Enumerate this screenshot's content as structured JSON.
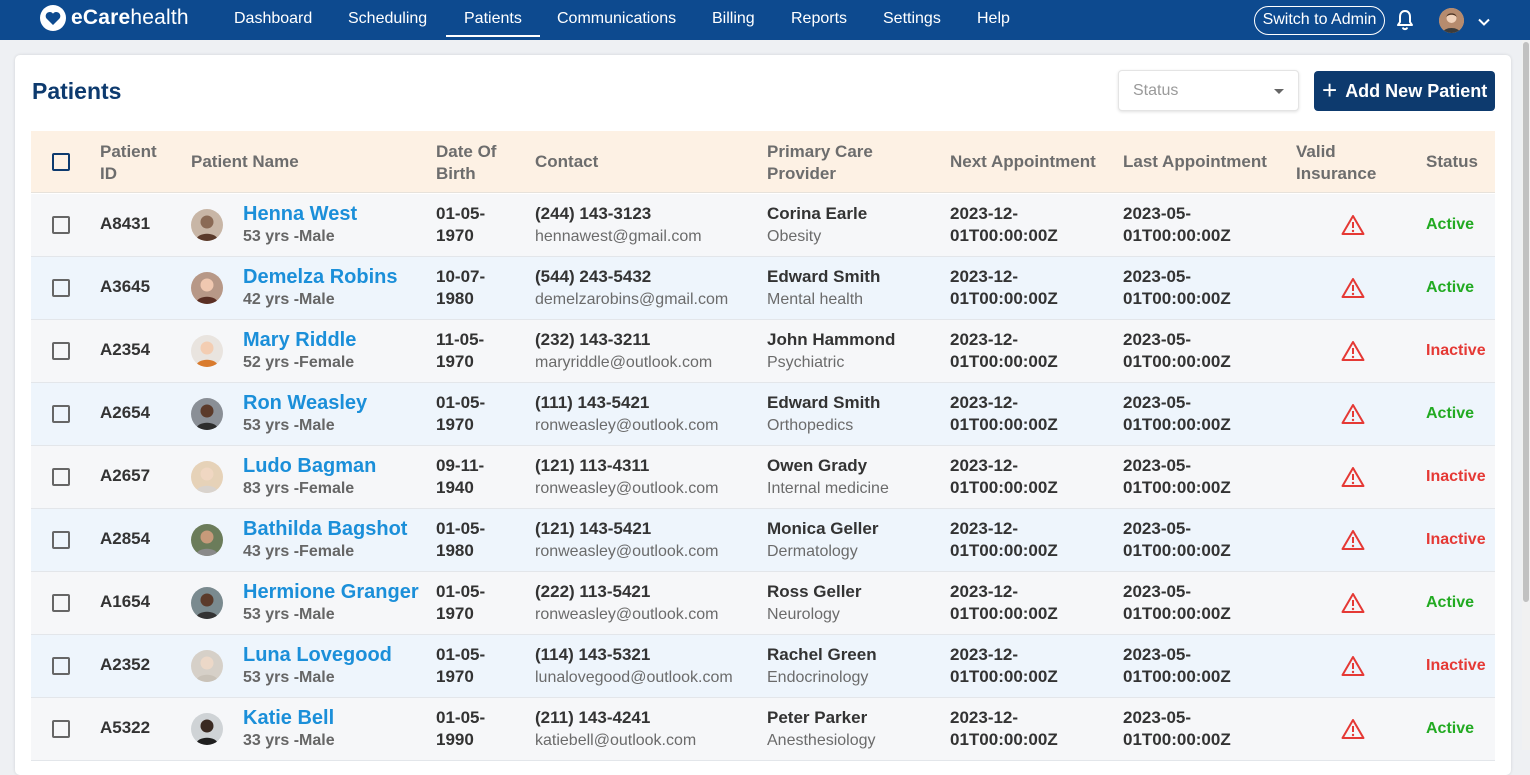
{
  "brand": {
    "name_bold": "eCare",
    "name_light": "health"
  },
  "nav": {
    "items": [
      {
        "label": "Dashboard",
        "active": false
      },
      {
        "label": "Scheduling",
        "active": false
      },
      {
        "label": "Patients",
        "active": true
      },
      {
        "label": "Communications",
        "active": false
      },
      {
        "label": "Billing",
        "active": false
      },
      {
        "label": "Reports",
        "active": false
      },
      {
        "label": "Settings",
        "active": false
      },
      {
        "label": "Help",
        "active": false
      }
    ],
    "switch_admin": "Switch to Admin"
  },
  "page": {
    "title": "Patients",
    "status_placeholder": "Status",
    "add_button": "Add New Patient"
  },
  "table": {
    "headers": {
      "patient_id": [
        "Patient",
        "ID"
      ],
      "patient_name": "Patient Name",
      "dob": [
        "Date Of",
        "Birth"
      ],
      "contact": "Contact",
      "pcp": [
        "Primary Care",
        "Provider"
      ],
      "next_appt": "Next Appointment",
      "last_appt": "Last Appointment",
      "insurance": [
        "Valid",
        "Insurance"
      ],
      "status": "Status"
    },
    "rows": [
      {
        "id": "A8431",
        "name": "Henna West",
        "meta": "53 yrs -Male",
        "dob": [
          "01-05-",
          "1970"
        ],
        "phone": "(244) 143-3123",
        "email": "hennawest@gmail.com",
        "provider": "Corina Earle",
        "specialty": "Obesity",
        "next": [
          "2023-12-",
          "01T00:00:00Z"
        ],
        "last": [
          "2023-05-",
          "01T00:00:00Z"
        ],
        "status": "Active"
      },
      {
        "id": "A3645",
        "name": "Demelza Robins",
        "meta": "42 yrs -Male",
        "dob": [
          "10-07-",
          "1980"
        ],
        "phone": "(544) 243-5432",
        "email": "demelzarobins@gmail.com",
        "provider": "Edward Smith",
        "specialty": "Mental health",
        "next": [
          "2023-12-",
          "01T00:00:00Z"
        ],
        "last": [
          "2023-05-",
          "01T00:00:00Z"
        ],
        "status": "Active"
      },
      {
        "id": "A2354",
        "name": "Mary Riddle",
        "meta": "52 yrs -Female",
        "dob": [
          "11-05-",
          "1970"
        ],
        "phone": "(232) 143-3211",
        "email": "maryriddle@outlook.com",
        "provider": "John Hammond",
        "specialty": "Psychiatric",
        "next": [
          "2023-12-",
          "01T00:00:00Z"
        ],
        "last": [
          "2023-05-",
          "01T00:00:00Z"
        ],
        "status": "Inactive"
      },
      {
        "id": "A2654",
        "name": "Ron Weasley",
        "meta": "53 yrs -Male",
        "dob": [
          "01-05-",
          "1970"
        ],
        "phone": "(111) 143-5421",
        "email": "ronweasley@outlook.com",
        "provider": "Edward Smith",
        "specialty": "Orthopedics",
        "next": [
          "2023-12-",
          "01T00:00:00Z"
        ],
        "last": [
          "2023-05-",
          "01T00:00:00Z"
        ],
        "status": "Active"
      },
      {
        "id": "A2657",
        "name": "Ludo Bagman",
        "meta": "83 yrs -Female",
        "dob": [
          "09-11-",
          "1940"
        ],
        "phone": "(121) 113-4311",
        "email": "ronweasley@outlook.com",
        "provider": "Owen Grady",
        "specialty": "Internal medicine",
        "next": [
          "2023-12-",
          "01T00:00:00Z"
        ],
        "last": [
          "2023-05-",
          "01T00:00:00Z"
        ],
        "status": "Inactive"
      },
      {
        "id": "A2854",
        "name": "Bathilda Bagshot",
        "meta": "43 yrs -Female",
        "dob": [
          "01-05-",
          "1980"
        ],
        "phone": "(121) 143-5421",
        "email": "ronweasley@outlook.com",
        "provider": "Monica Geller",
        "specialty": "Dermatology",
        "next": [
          "2023-12-",
          "01T00:00:00Z"
        ],
        "last": [
          "2023-05-",
          "01T00:00:00Z"
        ],
        "status": "Inactive"
      },
      {
        "id": "A1654",
        "name": "Hermione Granger",
        "meta": "53 yrs -Male",
        "dob": [
          "01-05-",
          "1970"
        ],
        "phone": "(222) 113-5421",
        "email": "ronweasley@outlook.com",
        "provider": "Ross Geller",
        "specialty": "Neurology",
        "next": [
          "2023-12-",
          "01T00:00:00Z"
        ],
        "last": [
          "2023-05-",
          "01T00:00:00Z"
        ],
        "status": "Active"
      },
      {
        "id": "A2352",
        "name": "Luna Lovegood",
        "meta": "53 yrs -Male",
        "dob": [
          "01-05-",
          "1970"
        ],
        "phone": "(114) 143-5321",
        "email": "lunalovegood@outlook.com",
        "provider": "Rachel Green",
        "specialty": "Endocrinology",
        "next": [
          "2023-12-",
          "01T00:00:00Z"
        ],
        "last": [
          "2023-05-",
          "01T00:00:00Z"
        ],
        "status": "Inactive"
      },
      {
        "id": "A5322",
        "name": "Katie Bell",
        "meta": "33 yrs -Male",
        "dob": [
          "01-05-",
          "1990"
        ],
        "phone": "(211) 143-4241",
        "email": "katiebell@outlook.com",
        "provider": "Peter Parker",
        "specialty": "Anesthesiology",
        "next": [
          "2023-12-",
          "01T00:00:00Z"
        ],
        "last": [
          "2023-05-",
          "01T00:00:00Z"
        ],
        "status": "Active"
      }
    ]
  },
  "colors": {
    "nav_bg": "#0d4a8f",
    "primary_dark": "#0d3a6e",
    "link": "#1b8fd9",
    "active": "#22aa22",
    "inactive": "#e53935",
    "warning": "#e53935",
    "header_bg": "#fdf1e4"
  },
  "icons": {
    "logo": "heart-logo-icon",
    "notification": "bell-icon",
    "user_menu": "chevron-down-icon",
    "insurance": "warning-triangle-icon",
    "add": "plus-icon"
  }
}
